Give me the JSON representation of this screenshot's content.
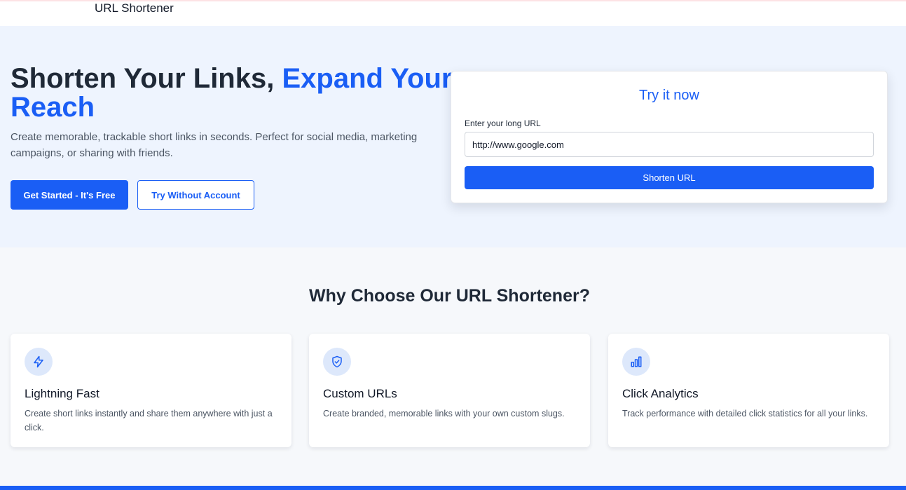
{
  "nav": {
    "title": "URL Shortener"
  },
  "hero": {
    "heading_part1": "Shorten Your Links, ",
    "heading_accent": "Expand Your Reach",
    "subtitle": "Create memorable, trackable short links in seconds. Perfect for social media, marketing campaigns, or sharing with friends.",
    "primary_button": "Get Started - It's Free",
    "secondary_button": "Try Without Account"
  },
  "try_card": {
    "title": "Try it now",
    "input_label": "Enter your long URL",
    "input_value": "http://www.google.com",
    "button_label": "Shorten URL"
  },
  "why": {
    "title": "Why Choose Our URL Shortener?",
    "features": [
      {
        "icon": "lightning-icon",
        "title": "Lightning Fast",
        "description": "Create short links instantly and share them anywhere with just a click."
      },
      {
        "icon": "shield-check-icon",
        "title": "Custom URLs",
        "description": "Create branded, memorable links with your own custom slugs."
      },
      {
        "icon": "bar-chart-icon",
        "title": "Click Analytics",
        "description": "Track performance with detailed click statistics for all your links."
      }
    ]
  },
  "colors": {
    "accent": "#1a5ef5",
    "hero_bg": "#eef4fe",
    "icon_bg": "#dde8fb"
  }
}
